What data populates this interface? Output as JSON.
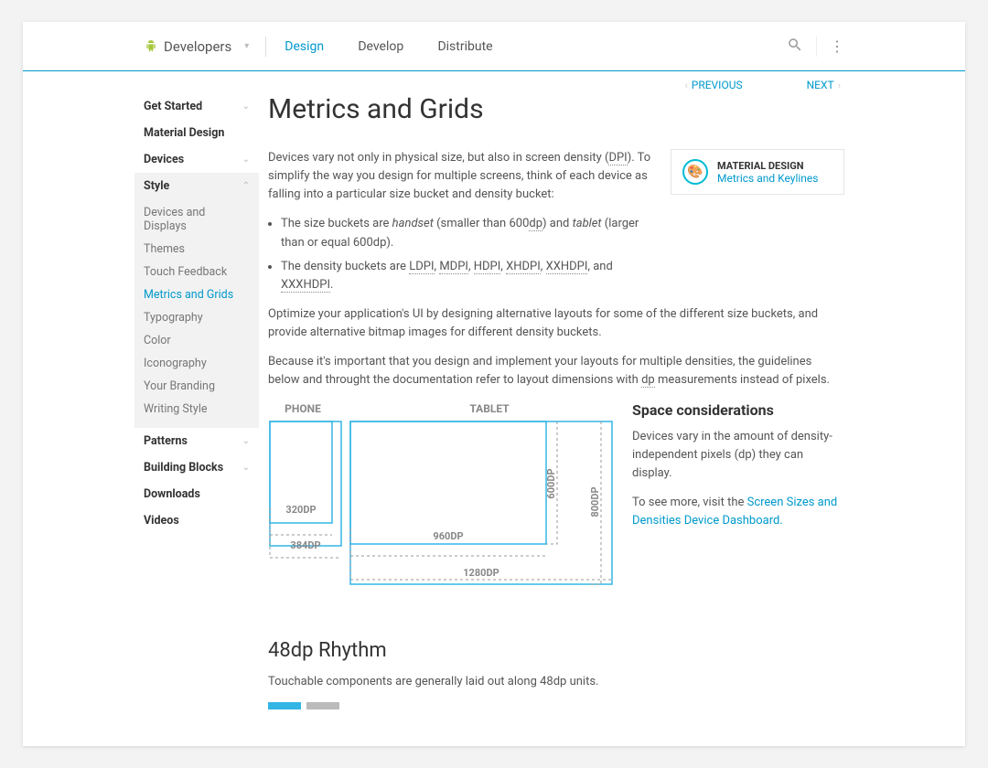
{
  "header": {
    "brand": "Developers",
    "nav": {
      "design": "Design",
      "develop": "Develop",
      "distribute": "Distribute"
    }
  },
  "pager": {
    "prev": "PREVIOUS",
    "next": "NEXT"
  },
  "sidebar": {
    "get_started": "Get Started",
    "material_design": "Material Design",
    "devices": "Devices",
    "style": "Style",
    "style_items": {
      "devices_displays": "Devices and Displays",
      "themes": "Themes",
      "touch_feedback": "Touch Feedback",
      "metrics_grids": "Metrics and Grids",
      "typography": "Typography",
      "color": "Color",
      "iconography": "Iconography",
      "your_branding": "Your Branding",
      "writing_style": "Writing Style"
    },
    "patterns": "Patterns",
    "building_blocks": "Building Blocks",
    "downloads": "Downloads",
    "videos": "Videos"
  },
  "page": {
    "title": "Metrics and Grids",
    "intro1a": "Devices vary not only in physical size, but also in screen density (",
    "intro1_dpi": "DPI",
    "intro1b": "). To simplify the way you design for multiple screens, think of each device as falling into a particular size bucket and density bucket:",
    "bullet1a": "The size buckets are ",
    "bullet1_hand": "handset",
    "bullet1b": " (smaller than 600",
    "bullet1_dp": "dp",
    "bullet1c": ") and ",
    "bullet1_tab": "tablet",
    "bullet1d": " (larger than or equal 600dp).",
    "bullet2a": "The density buckets are ",
    "bullet2_ldpi": "LDPI",
    "bullet2_mdpi": "MDPI",
    "bullet2_hdpi": "HDPI",
    "bullet2_xhdpi": "XHDPI",
    "bullet2_xxhdpi": "XXHDPI",
    "bullet2_and": ", and ",
    "bullet2_xxxhdpi": "XXXHDPI",
    "bullet2_end": ".",
    "para2": "Optimize your application's UI by designing alternative layouts for some of the different size buckets, and provide alternative bitmap images for different density buckets.",
    "para3a": "Because it's important that you design and implement your layouts for multiple densities, the guidelines below and throught the documentation refer to layout dimensions with ",
    "para3_dp": "dp",
    "para3b": " measurements instead of pixels.",
    "md_card": {
      "title": "MATERIAL DESIGN",
      "link": "Metrics and Keylines"
    },
    "figure": {
      "phone": "PHONE",
      "tablet": "TABLET",
      "d320": "320DP",
      "d384": "384DP",
      "d960": "960DP",
      "d1280": "1280DP",
      "d600": "600DP",
      "d800": "800DP"
    },
    "space": {
      "heading": "Space considerations",
      "p1": "Devices vary in the amount of density-independent pixels (dp) they can display.",
      "p2a": "To see more, visit the ",
      "p2link": "Screen Sizes and Densities Device Dashboard."
    },
    "rhythm": {
      "heading": "48dp Rhythm",
      "p1": "Touchable components are generally laid out along 48dp units."
    }
  }
}
